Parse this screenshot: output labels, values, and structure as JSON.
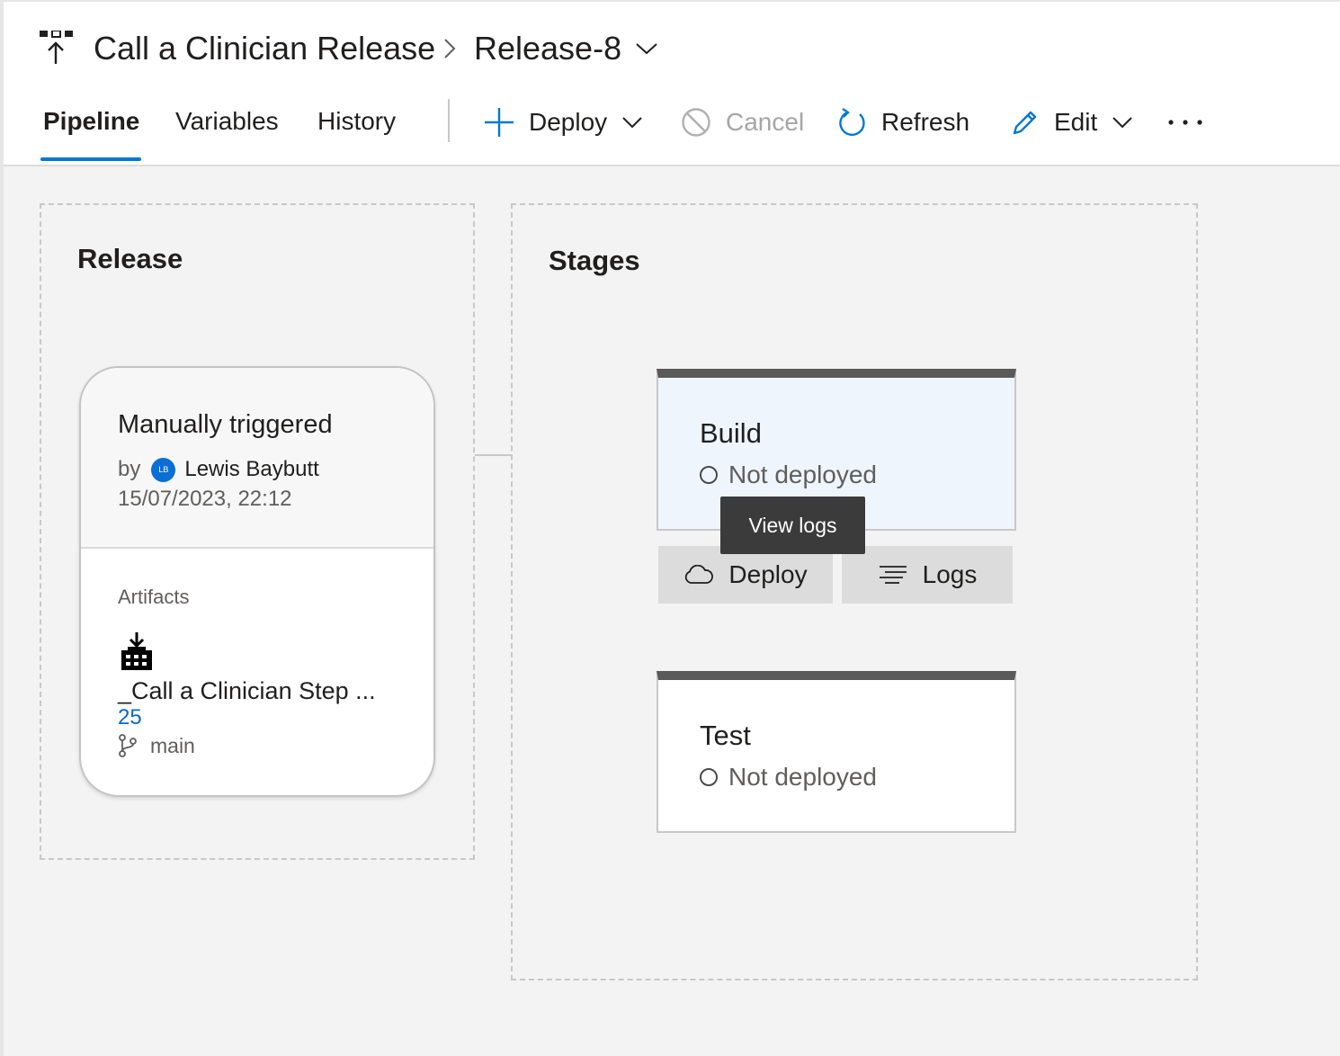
{
  "header": {
    "title": "Call a Clinician Release",
    "release_name": "Release-8",
    "pipeline_icon": "release-pipeline-icon",
    "breadcrumb_icon": "chevron-right-icon",
    "release_dropdown_icon": "chevron-down-icon"
  },
  "tabs": [
    {
      "label": "Pipeline",
      "active": true
    },
    {
      "label": "Variables",
      "active": false
    },
    {
      "label": "History",
      "active": false
    }
  ],
  "toolbar": {
    "deploy": {
      "label": "Deploy",
      "icon": "plus-icon"
    },
    "cancel": {
      "label": "Cancel",
      "icon": "cancel-icon",
      "disabled": true
    },
    "refresh": {
      "label": "Refresh",
      "icon": "refresh-icon"
    },
    "edit": {
      "label": "Edit",
      "icon": "pencil-icon"
    },
    "more_label": "···"
  },
  "release_section": {
    "title": "Release",
    "trigger": "Manually triggered",
    "by_label": "by",
    "avatar_initials": "LB",
    "user": "Lewis Baybutt",
    "date": "15/07/2023, 22:12",
    "artifacts_label": "Artifacts",
    "artifact": {
      "icon": "build-artifact-icon",
      "name": "_Call a Clinician Step ...",
      "version": "25",
      "branch_icon": "branch-icon",
      "branch": "main"
    }
  },
  "stages_section": {
    "title": "Stages",
    "stages": [
      {
        "name": "Build",
        "status": "Not deployed"
      },
      {
        "name": "Test",
        "status": "Not deployed"
      }
    ],
    "actions": {
      "deploy_label": "Deploy",
      "deploy_icon": "cloud-icon",
      "logs_label": "Logs",
      "logs_icon": "logs-icon"
    },
    "tooltip": "View logs"
  },
  "colors": {
    "accent": "#0078d4",
    "link": "#0b6ac2",
    "stage_header": "#5a5a5a",
    "stage_selected_bg": "#eff5fd",
    "tooltip_bg": "#3b3b3b"
  }
}
